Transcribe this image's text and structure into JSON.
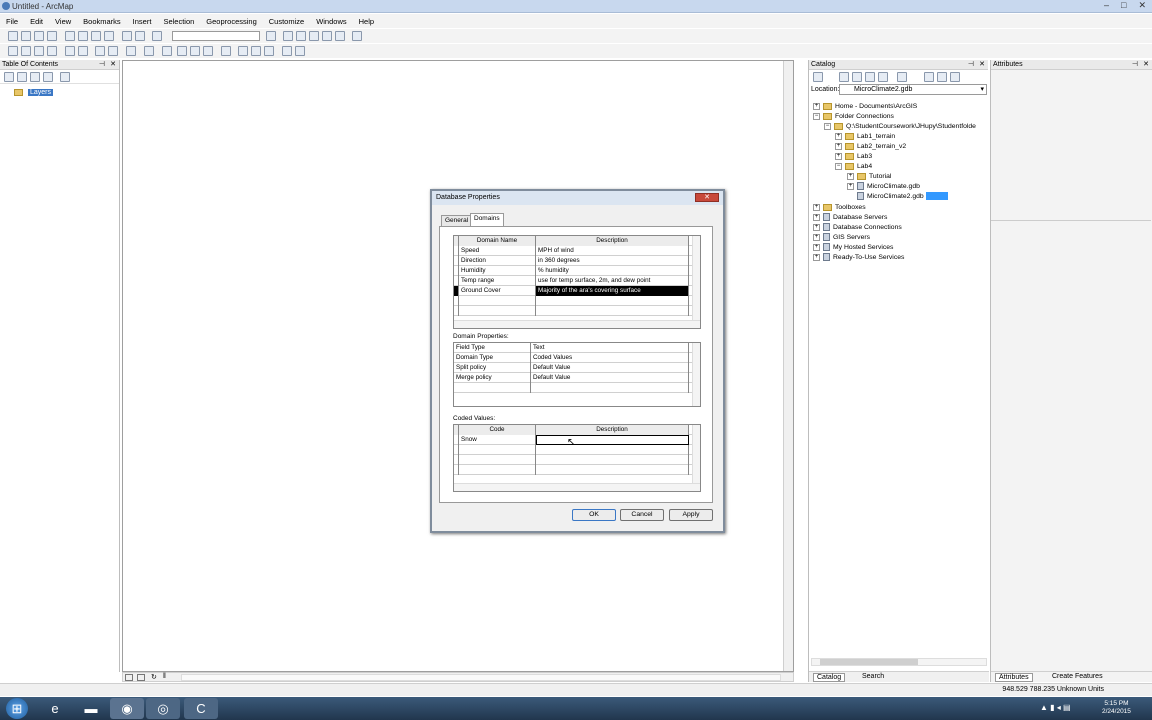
{
  "window": {
    "title": "Untitled - ArcMap"
  },
  "menu": [
    "File",
    "Edit",
    "View",
    "Bookmarks",
    "Insert",
    "Selection",
    "Geoprocessing",
    "Customize",
    "Windows",
    "Help"
  ],
  "toc": {
    "header": "Table Of Contents",
    "layers_label": "Layers"
  },
  "catalog": {
    "header": "Catalog",
    "location_label": "Location:",
    "location_value": "MicroClimate2.gdb",
    "tree": {
      "home": "Home - Documents\\ArcGIS",
      "folder_connections": "Folder Connections",
      "path": "Q:\\StudentCoursework\\JHupy\\Studentfolde",
      "lab1": "Lab1_terrain",
      "lab2": "Lab2_terrain_v2",
      "lab3": "Lab3",
      "lab4": "Lab4",
      "tutorial": "Tutorial",
      "mc": "MicroClimate.gdb",
      "mc2": "MicroClimate2.gdb",
      "toolboxes": "Toolboxes",
      "db_servers": "Database Servers",
      "db_connections": "Database Connections",
      "gis_servers": "GIS Servers",
      "hosted": "My Hosted Services",
      "ready": "Ready-To-Use Services"
    },
    "tabs": {
      "catalog": "Catalog",
      "search": "Search"
    }
  },
  "attributes": {
    "header": "Attributes",
    "tab_attributes": "Attributes",
    "tab_create": "Create Features"
  },
  "dialog": {
    "title": "Database Properties",
    "tabs": {
      "general": "General",
      "domains": "Domains"
    },
    "domains_grid": {
      "headers": {
        "name": "Domain Name",
        "desc": "Description"
      },
      "rows": [
        {
          "name": "Speed",
          "desc": "MPH of wind"
        },
        {
          "name": "Direction",
          "desc": "in 360 degrees"
        },
        {
          "name": "Humidity",
          "desc": "% humidity"
        },
        {
          "name": "Temp range",
          "desc": "use for temp surface, 2m, and dew point"
        },
        {
          "name": "Ground Cover",
          "desc": "Majority of the ara's covering surface"
        }
      ]
    },
    "domain_props_label": "Domain Properties:",
    "domain_props": [
      {
        "k": "Field Type",
        "v": "Text"
      },
      {
        "k": "Domain Type",
        "v": "Coded Values"
      },
      {
        "k": "Split policy",
        "v": "Default Value"
      },
      {
        "k": "Merge policy",
        "v": "Default Value"
      }
    ],
    "coded_values_label": "Coded Values:",
    "coded_grid": {
      "headers": {
        "code": "Code",
        "desc": "Description"
      },
      "rows": [
        {
          "code": "Snow",
          "desc": ""
        }
      ]
    },
    "buttons": {
      "ok": "OK",
      "cancel": "Cancel",
      "apply": "Apply"
    }
  },
  "status": {
    "coords": "948.529  788.235 Unknown Units"
  },
  "clock": {
    "time": "5:15 PM",
    "date": "2/24/2015"
  }
}
